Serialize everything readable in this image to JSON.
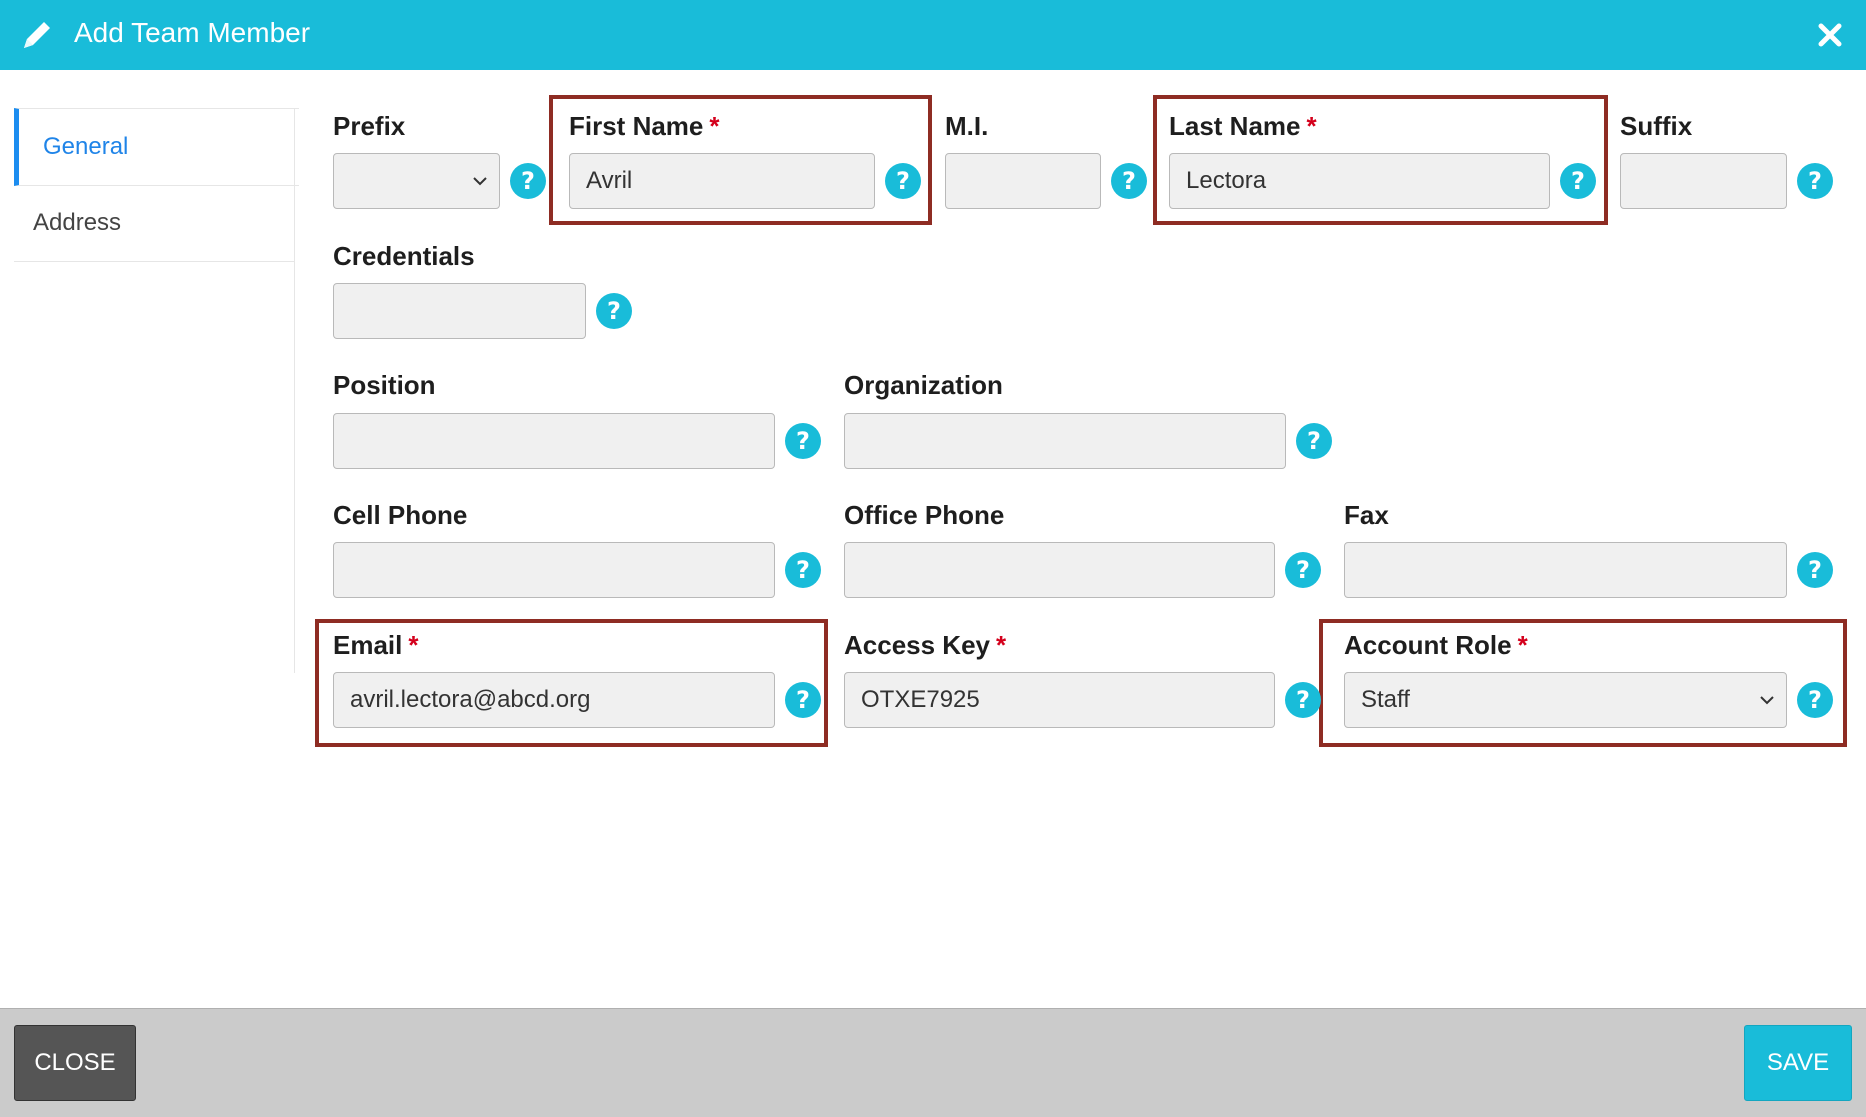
{
  "dialog": {
    "title": "Add Team Member",
    "close_icon": "close-icon",
    "edit_icon": "pencil-icon"
  },
  "tabs": [
    {
      "label": "General",
      "active": true
    },
    {
      "label": "Address",
      "active": false
    }
  ],
  "required_marker": "*",
  "form": {
    "prefix": {
      "label": "Prefix",
      "value": ""
    },
    "first_name": {
      "label": "First Name",
      "value": "Avril",
      "required": true
    },
    "mi": {
      "label": "M.I.",
      "value": ""
    },
    "last_name": {
      "label": "Last Name",
      "value": "Lectora",
      "required": true
    },
    "suffix": {
      "label": "Suffix",
      "value": ""
    },
    "credentials": {
      "label": "Credentials",
      "value": ""
    },
    "position": {
      "label": "Position",
      "value": ""
    },
    "organization": {
      "label": "Organization",
      "value": ""
    },
    "cell_phone": {
      "label": "Cell Phone",
      "value": ""
    },
    "office_phone": {
      "label": "Office Phone",
      "value": ""
    },
    "fax": {
      "label": "Fax",
      "value": ""
    },
    "email": {
      "label": "Email",
      "value": "avril.lectora@abcd.org",
      "required": true
    },
    "access_key": {
      "label": "Access Key",
      "value": "OTXE7925",
      "required": true
    },
    "account_role": {
      "label": "Account Role",
      "value": "Staff",
      "required": true
    }
  },
  "footer": {
    "close_label": "CLOSE",
    "save_label": "SAVE"
  },
  "colors": {
    "header": "#19bcd9",
    "accent": "#1f84e8",
    "required": "#d4001c",
    "highlight": "#8e2c23",
    "help": "#19bcd9"
  }
}
